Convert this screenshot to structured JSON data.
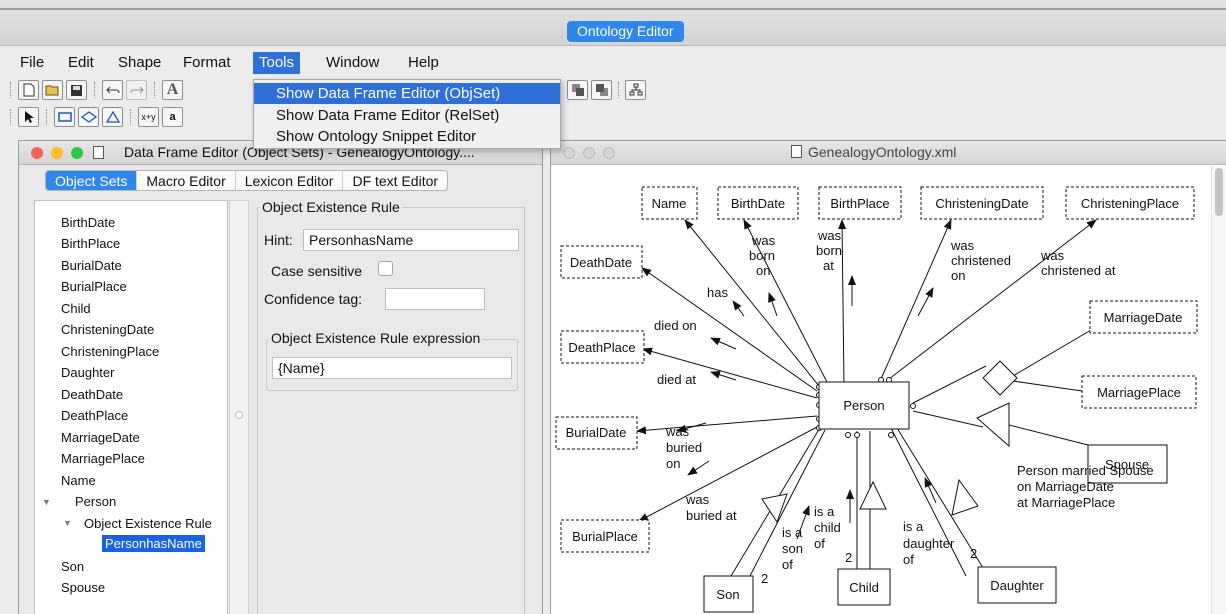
{
  "app": {
    "title": "Ontology Editor"
  },
  "menubar": {
    "items": [
      "File",
      "Edit",
      "Shape",
      "Format",
      "Tools",
      "Window",
      "Help"
    ],
    "active": "Tools"
  },
  "tools_menu": {
    "items": [
      "Show Data Frame Editor (ObjSet)",
      "Show Data Frame Editor (RelSet)",
      "Show Ontology Snippet Editor"
    ],
    "highlighted": "Show Data Frame Editor (ObjSet)"
  },
  "toolbar": {
    "row1_icons": [
      "new-document-icon",
      "open-folder-icon",
      "save-icon",
      "undo-icon",
      "redo-icon",
      "text-tool-icon",
      "bring-front-icon",
      "send-back-icon",
      "layout-icon"
    ],
    "row2_icons": [
      "pointer-icon",
      "rectangle-tool-icon",
      "diamond-tool-icon",
      "triangle-tool-icon",
      "formula-icon",
      "label-tool-icon"
    ],
    "formula_label": "x+y",
    "label_tool_label": "a"
  },
  "data_frame_window": {
    "title": "Data Frame Editor (Object Sets) - GenealogyOntology....",
    "tabs": [
      "Object Sets",
      "Macro Editor",
      "Lexicon Editor",
      "DF text Editor"
    ],
    "active_tab": "Object Sets",
    "tree": {
      "items": [
        "BirthDate",
        "BirthPlace",
        "BurialDate",
        "BurialPlace",
        "Child",
        "ChristeningDate",
        "ChristeningPlace",
        "Daughter",
        "DeathDate",
        "DeathPlace",
        "MarriageDate",
        "MarriagePlace",
        "Name"
      ],
      "person": "Person",
      "rule_node": "Object Existence Rule",
      "selected": "PersonhasName",
      "after": [
        "Son",
        "Spouse"
      ]
    },
    "rule_panel": {
      "group_title": "Object Existence Rule",
      "hint_label": "Hint:",
      "hint_value": "PersonhasName",
      "case_label": "Case sensitive",
      "case_checked": false,
      "confidence_label": "Confidence tag:",
      "confidence_value": "",
      "expr_group_title": "Object Existence Rule expression",
      "expr_value": "{Name}"
    }
  },
  "ontology_window": {
    "title": "GenealogyOntology.xml",
    "diagram": {
      "center": "Person",
      "object_sets": [
        "Name",
        "BirthDate",
        "BirthPlace",
        "ChristeningDate",
        "ChristeningPlace",
        "DeathDate",
        "DeathPlace",
        "BurialDate",
        "BurialPlace",
        "MarriageDate",
        "MarriagePlace"
      ],
      "lexical_boxes": [
        "Spouse",
        "Son",
        "Child",
        "Daughter"
      ],
      "relationship_labels": {
        "has": "has",
        "born_on": [
          "was",
          "born",
          "on"
        ],
        "born_at": [
          "was",
          "born",
          "at"
        ],
        "christened_on": [
          "was",
          "christened",
          "on"
        ],
        "christened_at": [
          "was",
          "christened at"
        ],
        "died_on": "died on",
        "died_at": "died at",
        "buried_on": [
          "was",
          "buried",
          "on"
        ],
        "buried_at": [
          "was",
          "buried at"
        ],
        "son_of": [
          "is a",
          "son",
          "of"
        ],
        "child_of": [
          "is a",
          "child",
          "of"
        ],
        "daughter_of": [
          "is a",
          "daughter",
          "of"
        ],
        "marriage_note": [
          "Person married Spouse",
          "on MarriageDate",
          "at MarriagePlace"
        ]
      },
      "multiplicities": {
        "son": "2",
        "child": "2",
        "daughter": "2"
      }
    }
  },
  "colors": {
    "accent": "#2f87ea",
    "menu_highlight": "#2f6fd8",
    "selection": "#1763e0",
    "close_dot": "#fc5f57",
    "minimize_dot": "#fdbc2e",
    "zoom_dot": "#28c840"
  }
}
